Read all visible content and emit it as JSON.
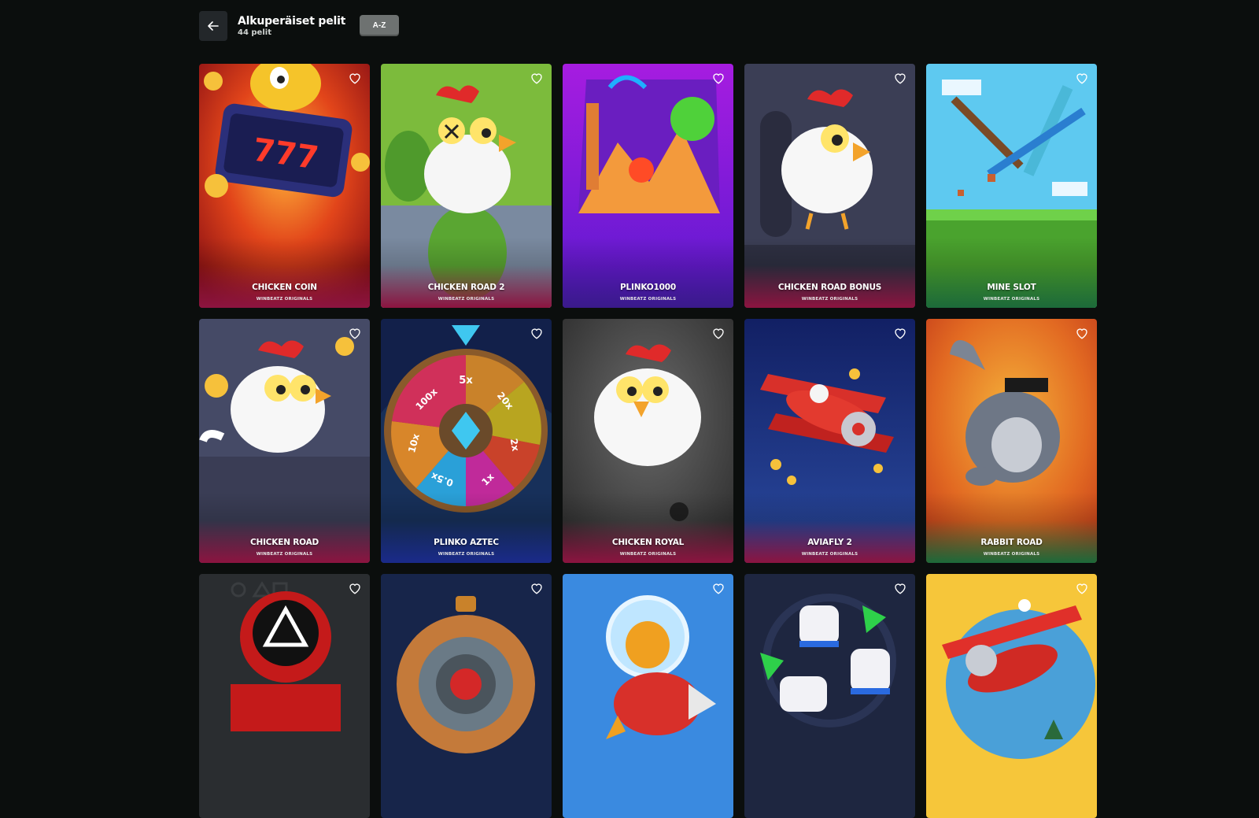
{
  "header": {
    "title": "Alkuperäiset pelit",
    "subtitle": "44 pelit",
    "sort_label": "A-Z",
    "back_icon": "arrow-left-icon"
  },
  "games": [
    {
      "name": "CHICKEN COIN",
      "brand": "WINBEATZ ORIGINALS"
    },
    {
      "name": "CHICKEN ROAD 2",
      "brand": "WINBEATZ ORIGINALS"
    },
    {
      "name": "PLINKO1000",
      "brand": "WINBEATZ ORIGINALS"
    },
    {
      "name": "CHICKEN ROAD BONUS",
      "brand": "WINBEATZ ORIGINALS"
    },
    {
      "name": "MINE SLOT",
      "brand": "WINBEATZ ORIGINALS"
    },
    {
      "name": "CHICKEN ROAD",
      "brand": "WINBEATZ ORIGINALS"
    },
    {
      "name": "PLINKO AZTEC",
      "brand": "WINBEATZ ORIGINALS",
      "wheel": [
        "5x",
        "20x",
        "2x",
        "1x",
        "0.5x",
        "10x",
        "100x"
      ]
    },
    {
      "name": "CHICKEN ROYAL",
      "brand": "WINBEATZ ORIGINALS"
    },
    {
      "name": "AVIAFLY 2",
      "brand": "WINBEATZ ORIGINALS"
    },
    {
      "name": "RABBIT ROAD",
      "brand": "WINBEATZ ORIGINALS"
    },
    {
      "name": "",
      "brand": ""
    },
    {
      "name": "",
      "brand": ""
    },
    {
      "name": "",
      "brand": ""
    },
    {
      "name": "",
      "brand": ""
    },
    {
      "name": "",
      "brand": ""
    }
  ],
  "colors": {
    "page_bg": "#0b0e0d",
    "sort_button": "#6e7271",
    "back_button": "#23272a"
  }
}
